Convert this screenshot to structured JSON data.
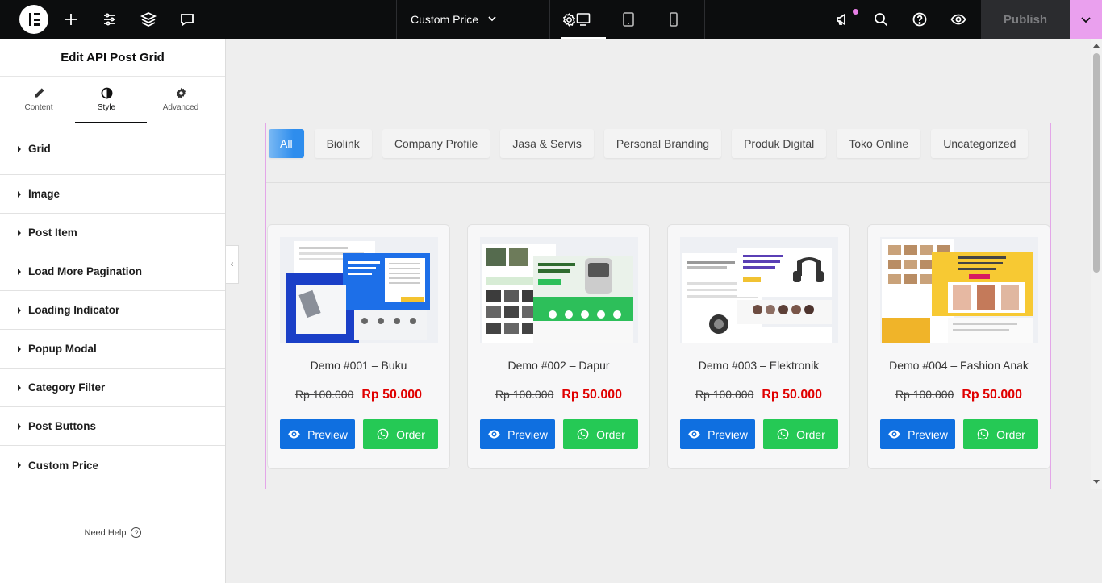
{
  "topbar": {
    "page_name": "Custom Price",
    "publish_label": "Publish"
  },
  "sidebar": {
    "title": "Edit API Post Grid",
    "tabs": [
      {
        "label": "Content",
        "icon": "pencil-icon"
      },
      {
        "label": "Style",
        "icon": "half-circle-icon",
        "active": true
      },
      {
        "label": "Advanced",
        "icon": "gear-icon"
      }
    ],
    "sections": [
      "Grid",
      "Image",
      "Post Item",
      "Load More Pagination",
      "Loading Indicator",
      "Popup Modal",
      "Category Filter",
      "Post Buttons",
      "Custom Price"
    ],
    "need_help": "Need Help"
  },
  "filters": [
    "All",
    "Biolink",
    "Company Profile",
    "Jasa & Servis",
    "Personal Branding",
    "Produk Digital",
    "Toko Online",
    "Uncategorized"
  ],
  "cards": [
    {
      "title": "Demo #001 – Buku",
      "old_price": "Rp 100.000",
      "new_price": "Rp 50.000",
      "preview": "Preview",
      "order": "Order"
    },
    {
      "title": "Demo #002 – Dapur",
      "old_price": "Rp 100.000",
      "new_price": "Rp 50.000",
      "preview": "Preview",
      "order": "Order"
    },
    {
      "title": "Demo #003 – Elektronik",
      "old_price": "Rp 100.000",
      "new_price": "Rp 50.000",
      "preview": "Preview",
      "order": "Order"
    },
    {
      "title": "Demo #004 – Fashion Anak",
      "old_price": "Rp 100.000",
      "new_price": "Rp 50.000",
      "preview": "Preview",
      "order": "Order"
    }
  ],
  "colors": {
    "topbar": "#0c0d0e",
    "accent_pink": "#eaa0ee",
    "preview_button": "#0f6fe0",
    "order_button": "#25c955",
    "new_price": "#e00000"
  }
}
